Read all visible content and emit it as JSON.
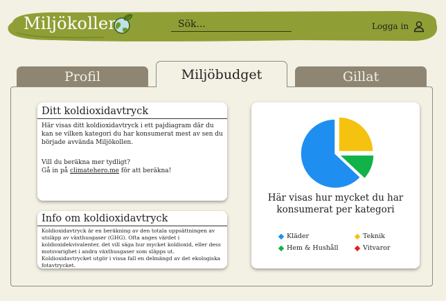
{
  "header": {
    "brand": "Miljökollen",
    "search_placeholder": "Sök...",
    "login_label": "Logga in"
  },
  "tabs": [
    {
      "label": "Profil",
      "active": false
    },
    {
      "label": "Miljöbudget",
      "active": true
    },
    {
      "label": "Gillat",
      "active": false
    }
  ],
  "footprint_card": {
    "title": "Ditt koldioxidavtryck",
    "description": "Här visas ditt koldioxidavtryck i ett pajdiagram där du kan se vilken kategori du har konsumerat mest av sen du började avvända Miljökollen.",
    "more_prompt": "Vill du beräkna mer tydligt?",
    "link_prefix": "Gå in på ",
    "link_text": "climatehero.me",
    "link_suffix": " för att beräkna!"
  },
  "info_card": {
    "title": "Info om koldioxidavtryck",
    "body": "Koldioxidavtryck är en beräkning av den totala uppsättningen av utsläpp av växthusgaser (GHG). Ofta anges värdet i koldioxidekvivalenter, det vill säga hur mycket koldioxid, eller dess motsvarighet i andra växthusgaser som släpps ut. Koldioxidavtrycket utgör i vissa fall en delmängd av det ekologiska fotavtrycket."
  },
  "chart_card": {
    "caption": "Här visas hur mycket du har konsumerat per kategori"
  },
  "colors": {
    "header_green": "#8f9f35",
    "tab_inactive": "#8e8673",
    "background": "#f3f0e4"
  },
  "chart_data": {
    "type": "pie",
    "title": "",
    "categories": [
      "Kläder",
      "Teknik",
      "Hem & Hushåll",
      "Vitvaror"
    ],
    "values": [
      63,
      25,
      12,
      0
    ],
    "colors": [
      "#1e8ff1",
      "#f5c20f",
      "#12b24a",
      "#e02020"
    ],
    "legend_position": "bottom"
  }
}
